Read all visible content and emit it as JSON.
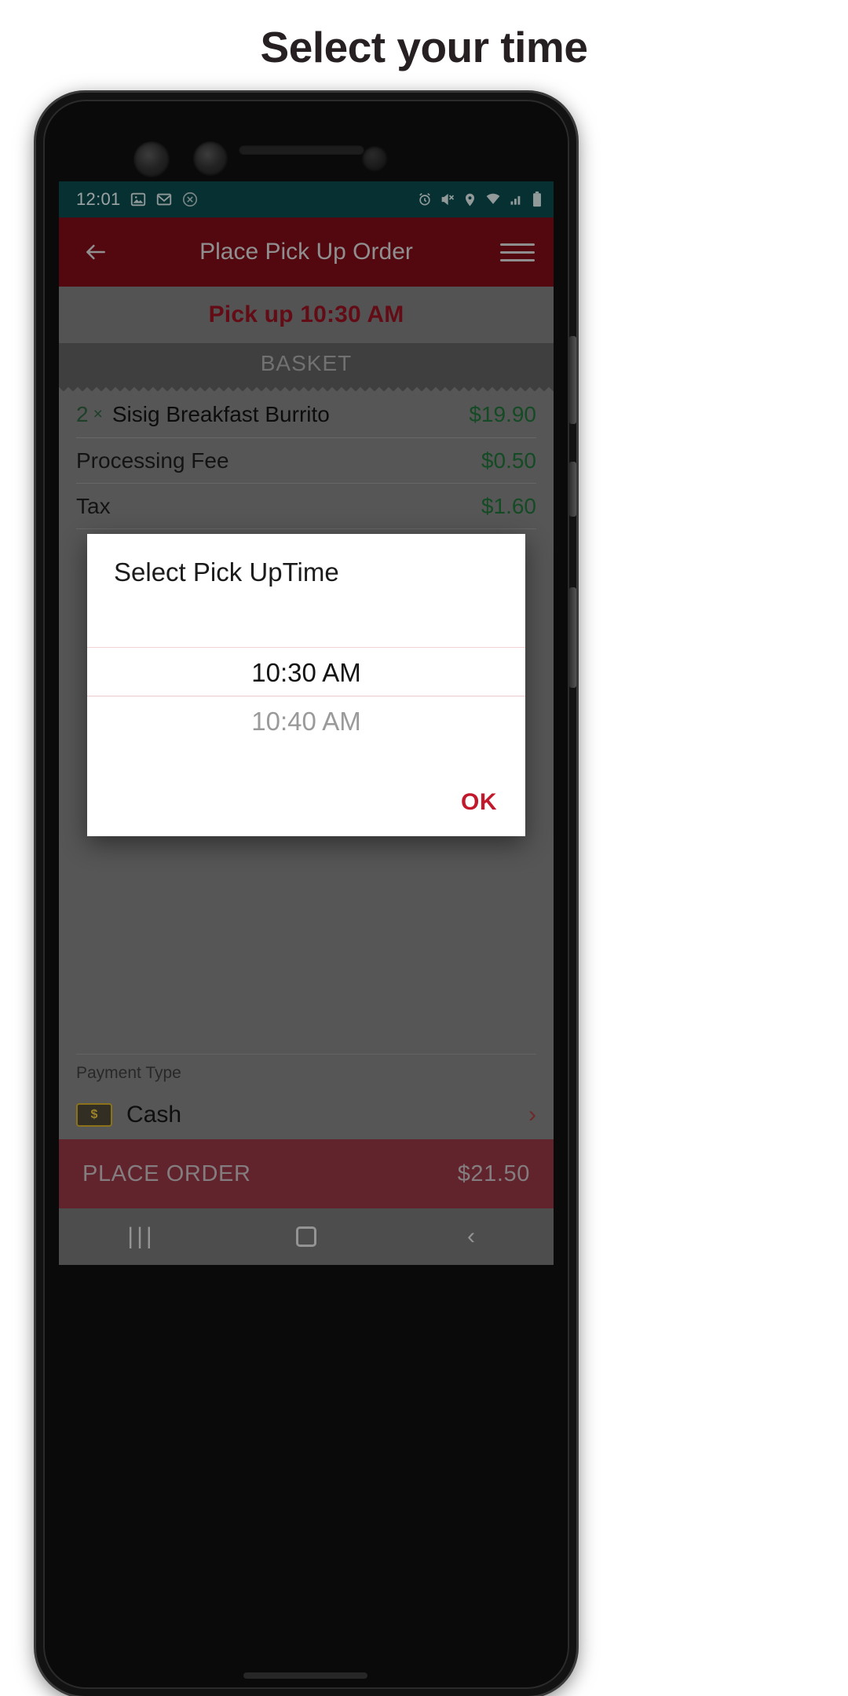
{
  "page": {
    "title": "Select your time"
  },
  "status_bar": {
    "clock": "12:01",
    "left_icons": [
      "image-icon",
      "gmail-icon",
      "circle-x-icon"
    ],
    "right_icons": [
      "alarm-icon",
      "mute-icon",
      "location-icon",
      "wifi-icon",
      "signal-icon",
      "battery-icon"
    ],
    "background": "#0b4549"
  },
  "app_bar": {
    "back_icon": "back-arrow-icon",
    "title": "Place Pick Up Order",
    "menu_icon": "hamburger-menu-icon",
    "background": "#780c16"
  },
  "pickup_banner": {
    "text": "Pick up 10:30 AM",
    "color": "#8e1220"
  },
  "basket": {
    "header": "BASKET",
    "items": [
      {
        "qty": "2",
        "times": "×",
        "name": "Sisig Breakfast Burrito",
        "price": "$19.90"
      }
    ],
    "totals": [
      {
        "label": "Processing Fee",
        "price": "$0.50"
      },
      {
        "label": "Tax",
        "price": "$1.60"
      }
    ],
    "price_color": "#1d6b34"
  },
  "payment": {
    "label": "Payment Type",
    "method": "Cash",
    "icon": "money-bill-icon",
    "chevron_icon": "chevron-right-icon"
  },
  "place_order": {
    "label": "PLACE ORDER",
    "total": "$21.50",
    "background": "#8c3340"
  },
  "nav_bar": {
    "recents_icon": "recents-icon",
    "home_icon": "home-icon",
    "back_icon": "back-icon"
  },
  "dialog": {
    "title": "Select Pick UpTime",
    "picker": {
      "selected": "10:30 AM",
      "next": "10:40 AM",
      "options": [
        "10:30 AM",
        "10:40 AM"
      ],
      "divider_color": "#f0d4d4"
    },
    "ok_label": "OK",
    "ok_color": "#c2182b"
  }
}
